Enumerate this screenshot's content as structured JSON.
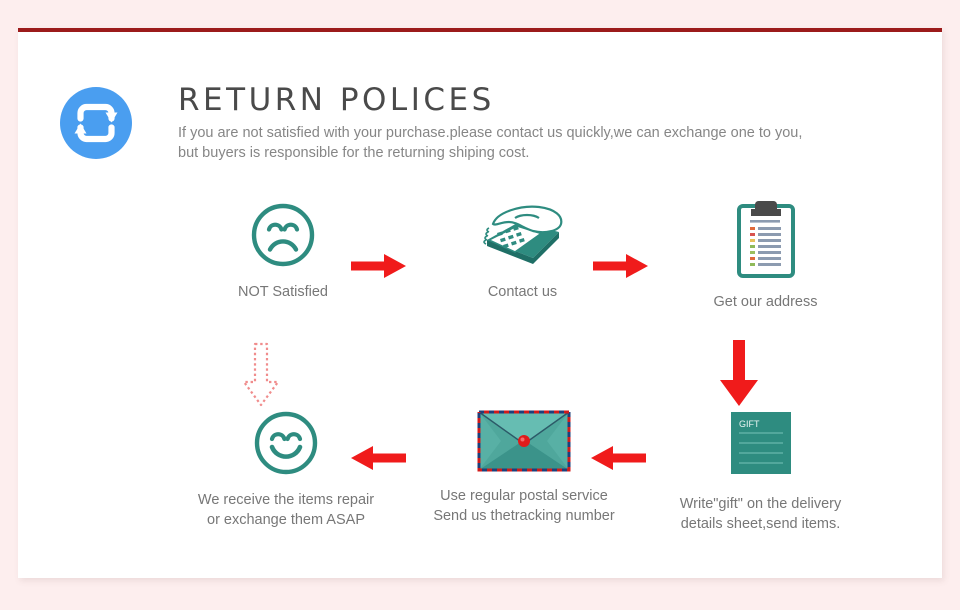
{
  "theme": {
    "page_background": "#fdeeee",
    "card_background": "#ffffff",
    "card_top_border": "#9c1b1b",
    "accent_teal": "#2e8c80",
    "accent_red": "#f01b1b",
    "accent_blue": "#4a9ef0",
    "title_color": "#4a4a4a",
    "body_text_color": "#868686",
    "label_text_color": "#777777"
  },
  "header": {
    "logo_icon": "return-cycle-icon",
    "title": "RETURN POLICES",
    "subtitle_line1": "If you are not satisfied with your purchase.please contact us quickly,we can exchange one to you,",
    "subtitle_line2": "but buyers is responsible for the returning shiping cost."
  },
  "flow": {
    "steps": [
      {
        "id": "not-satisfied",
        "icon": "sad-face-icon",
        "label": "NOT Satisfied"
      },
      {
        "id": "contact-us",
        "icon": "telephone-icon",
        "label": "Contact us"
      },
      {
        "id": "get-our-address",
        "icon": "clipboard-icon",
        "label": "Get our address"
      },
      {
        "id": "write-gift",
        "icon": "gift-parcel-icon",
        "label": "Write\"gift\" on the delivery\ndetails sheet,send items."
      },
      {
        "id": "postal-service",
        "icon": "envelope-icon",
        "label": "Use regular postal service\nSend us thetracking number"
      },
      {
        "id": "items-received",
        "icon": "happy-face-icon",
        "label": "We receive the items repair\nor exchange them ASAP"
      }
    ],
    "arrows": [
      {
        "id": "arrow-right-1",
        "icon": "arrow-right-icon",
        "style": "solid"
      },
      {
        "id": "arrow-right-2",
        "icon": "arrow-right-icon",
        "style": "solid"
      },
      {
        "id": "arrow-down-right",
        "icon": "arrow-down-icon",
        "style": "solid"
      },
      {
        "id": "arrow-left-1",
        "icon": "arrow-left-icon",
        "style": "solid"
      },
      {
        "id": "arrow-left-2",
        "icon": "arrow-left-icon",
        "style": "solid"
      },
      {
        "id": "arrow-down-left",
        "icon": "arrow-down-dotted-icon",
        "style": "dotted"
      }
    ]
  },
  "gift_box": {
    "tag_text": "GIFT"
  }
}
